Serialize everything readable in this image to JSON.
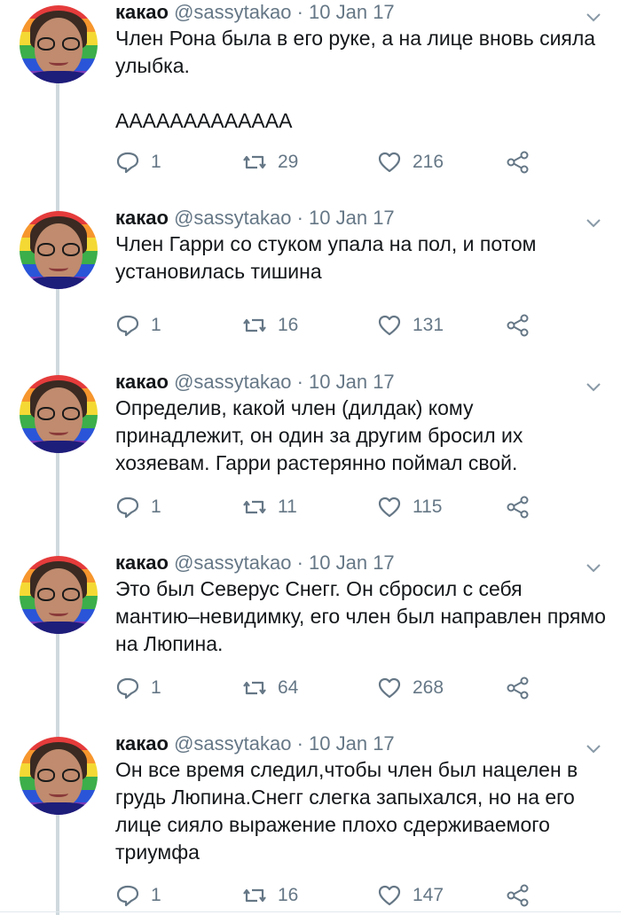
{
  "tweets": [
    {
      "name": "какао",
      "handle": "@sassytakao",
      "dot": "·",
      "date": "10 Jan 17",
      "lines": [
        "Член Рона была в его руке, а на лице вновь сияла улыбка.",
        "ААААААААААААА"
      ],
      "replies": "1",
      "retweets": "29",
      "likes": "216"
    },
    {
      "name": "какао",
      "handle": "@sassytakao",
      "dot": "·",
      "date": "10 Jan 17",
      "lines": [
        "Член Гарри со стуком упала на пол, и потом установилась тишина"
      ],
      "replies": "1",
      "retweets": "16",
      "likes": "131"
    },
    {
      "name": "какао",
      "handle": "@sassytakao",
      "dot": "·",
      "date": "10 Jan 17",
      "lines": [
        "Определив, какой член (дилдак) кому принадлежит, он один за другим бросил их хозяевам. Гарри растерянно поймал свой."
      ],
      "replies": "1",
      "retweets": "11",
      "likes": "115"
    },
    {
      "name": "какао",
      "handle": "@sassytakao",
      "dot": "·",
      "date": "10 Jan 17",
      "lines": [
        "Это был Северус Снегг. Он сбросил с себя мантию–невидимку, его член был направлен прямо на Люпина."
      ],
      "replies": "1",
      "retweets": "64",
      "likes": "268"
    },
    {
      "name": "какао",
      "handle": "@sassytakao",
      "dot": "·",
      "date": "10 Jan 17",
      "lines": [
        "Он все время следил,чтобы член был нацелен в грудь Люпина.Снегг слегка запыхался, но на его лице сияло выражение плохо сдерживаемого триумфа"
      ],
      "replies": "1",
      "retweets": "16",
      "likes": "147"
    }
  ],
  "colors": {
    "text": "#14171a",
    "muted": "#657786",
    "thread_line": "#cfd9de"
  },
  "icons": [
    "reply-icon",
    "retweet-icon",
    "like-icon",
    "share-icon",
    "chevron-down-icon"
  ]
}
